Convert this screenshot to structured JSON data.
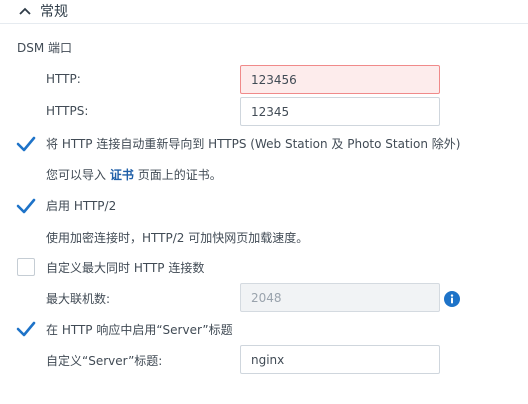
{
  "section": {
    "title": "常规"
  },
  "dsm_port": {
    "group_label": "DSM 端口",
    "http": {
      "label": "HTTP:",
      "value": "123456"
    },
    "https": {
      "label": "HTTPS:",
      "value": "12345"
    }
  },
  "redirect": {
    "label": "将 HTTP 连接自动重新导向到 HTTPS (Web Station 及 Photo Station 除外)",
    "note_prefix": "您可以导入",
    "note_link": "证书",
    "note_suffix": "页面上的证书。",
    "checked": true
  },
  "http2": {
    "label": "启用 HTTP/2",
    "note": "使用加密连接时，HTTP/2 可加快网页加载速度。",
    "checked": true
  },
  "max_connections": {
    "label": "自定义最大同时 HTTP 连接数",
    "field_label": "最大联机数:",
    "value": "2048",
    "checked": false
  },
  "server_header": {
    "label": "在 HTTP 响应中启用“Server”标题",
    "field_label": "自定义“Server”标题:",
    "value": "nginx",
    "checked": true
  },
  "colors": {
    "accent": "#1e73c8",
    "error_bg": "#fdecec",
    "error_border": "#f08a8a"
  }
}
